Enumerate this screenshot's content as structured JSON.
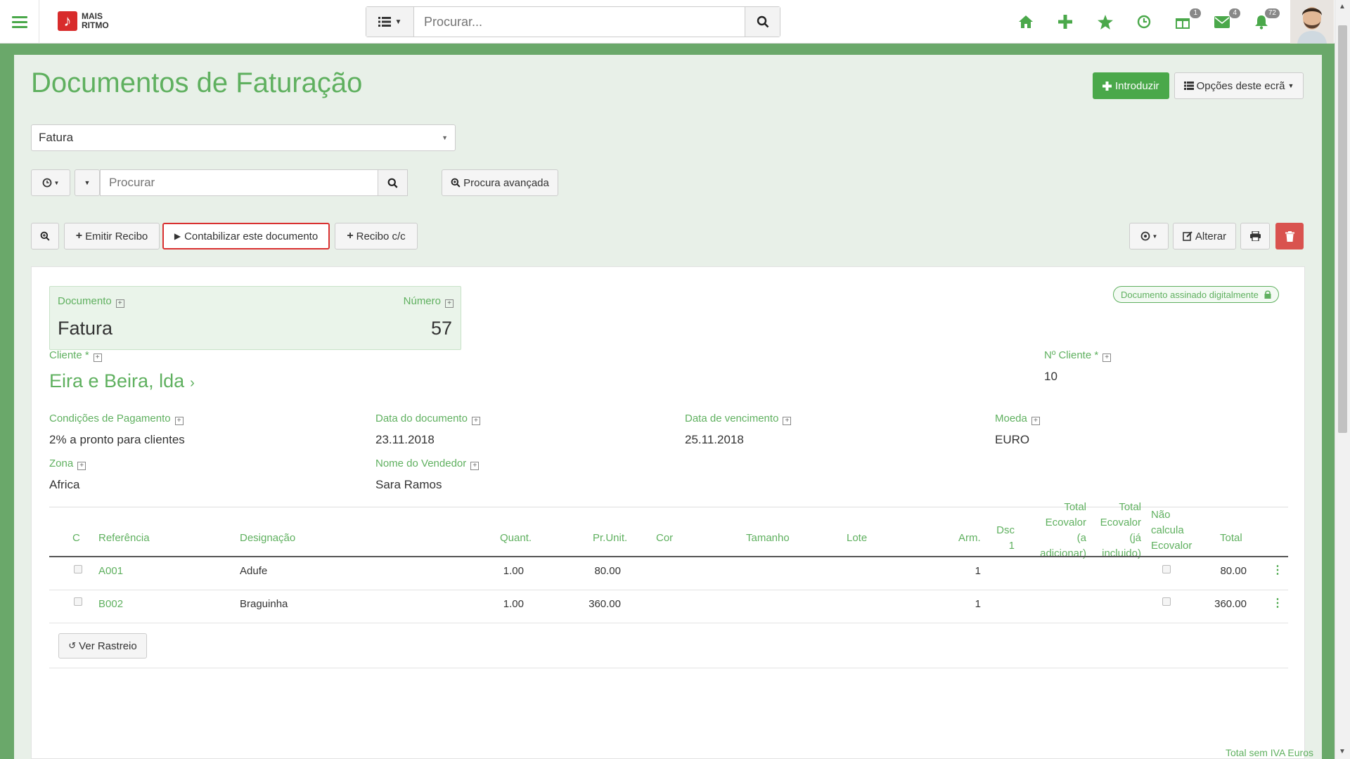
{
  "topbar": {
    "logo_line1": "MAIS",
    "logo_line2": "RITMO",
    "search_placeholder": "Procurar...",
    "badges": {
      "gift": "1",
      "mail": "4",
      "bell": "72"
    },
    "accent": "#4aa84a"
  },
  "header": {
    "title": "Documentos de Faturação",
    "introduzir_label": "Introduzir",
    "options_label": "Opções deste ecrã"
  },
  "filter": {
    "doc_type": "Fatura",
    "search_placeholder": "Procurar",
    "advanced_label": "Procura avançada"
  },
  "toolbar": {
    "emitir_recibo": "Emitir Recibo",
    "contabilizar": "Contabilizar este documento",
    "recibo_cc": "Recibo c/c",
    "alterar": "Alterar"
  },
  "document": {
    "doc_label": "Documento",
    "doc_value": "Fatura",
    "num_label": "Número",
    "num_value": "57",
    "signed_label": "Documento assinado digitalmente",
    "cliente_label": "Cliente *",
    "cliente_value": "Eira e Beira, lda",
    "ncliente_label": "Nº Cliente *",
    "ncliente_value": "10",
    "cond_label": "Condições de Pagamento",
    "cond_value": "2% a pronto para clientes",
    "data_doc_label": "Data do documento",
    "data_doc_value": "23.11.2018",
    "data_venc_label": "Data de vencimento",
    "data_venc_value": "25.11.2018",
    "moeda_label": "Moeda",
    "moeda_value": "EURO",
    "zona_label": "Zona",
    "zona_value": "Africa",
    "vendedor_label": "Nome do Vendedor",
    "vendedor_value": "Sara Ramos"
  },
  "table": {
    "headers": {
      "c": "C",
      "ref": "Referência",
      "desig": "Designação",
      "quant": "Quant.",
      "prunit": "Pr.Unit.",
      "cor": "Cor",
      "tamanho": "Tamanho",
      "lote": "Lote",
      "arm": "Arm.",
      "dsc1_a": "Dsc",
      "dsc1_b": "1",
      "eco_add_1": "Total",
      "eco_add_2": "Ecovalor",
      "eco_add_3": "(a",
      "eco_add_4": "adicionar)",
      "eco_inc_1": "Total",
      "eco_inc_2": "Ecovalor",
      "eco_inc_3": "(já",
      "eco_inc_4": "incluido)",
      "nao_1": "Não",
      "nao_2": "calcula",
      "nao_3": "Ecovalor",
      "total": "Total"
    },
    "rows": [
      {
        "ref": "A001",
        "desig": "Adufe",
        "quant": "1.00",
        "prunit": "80.00",
        "arm": "1",
        "total": "80.00"
      },
      {
        "ref": "B002",
        "desig": "Braguinha",
        "quant": "1.00",
        "prunit": "360.00",
        "arm": "1",
        "total": "360.00"
      }
    ],
    "rastreio_label": "Ver Rastreio",
    "footer_label": "Total sem IVA Euros"
  }
}
